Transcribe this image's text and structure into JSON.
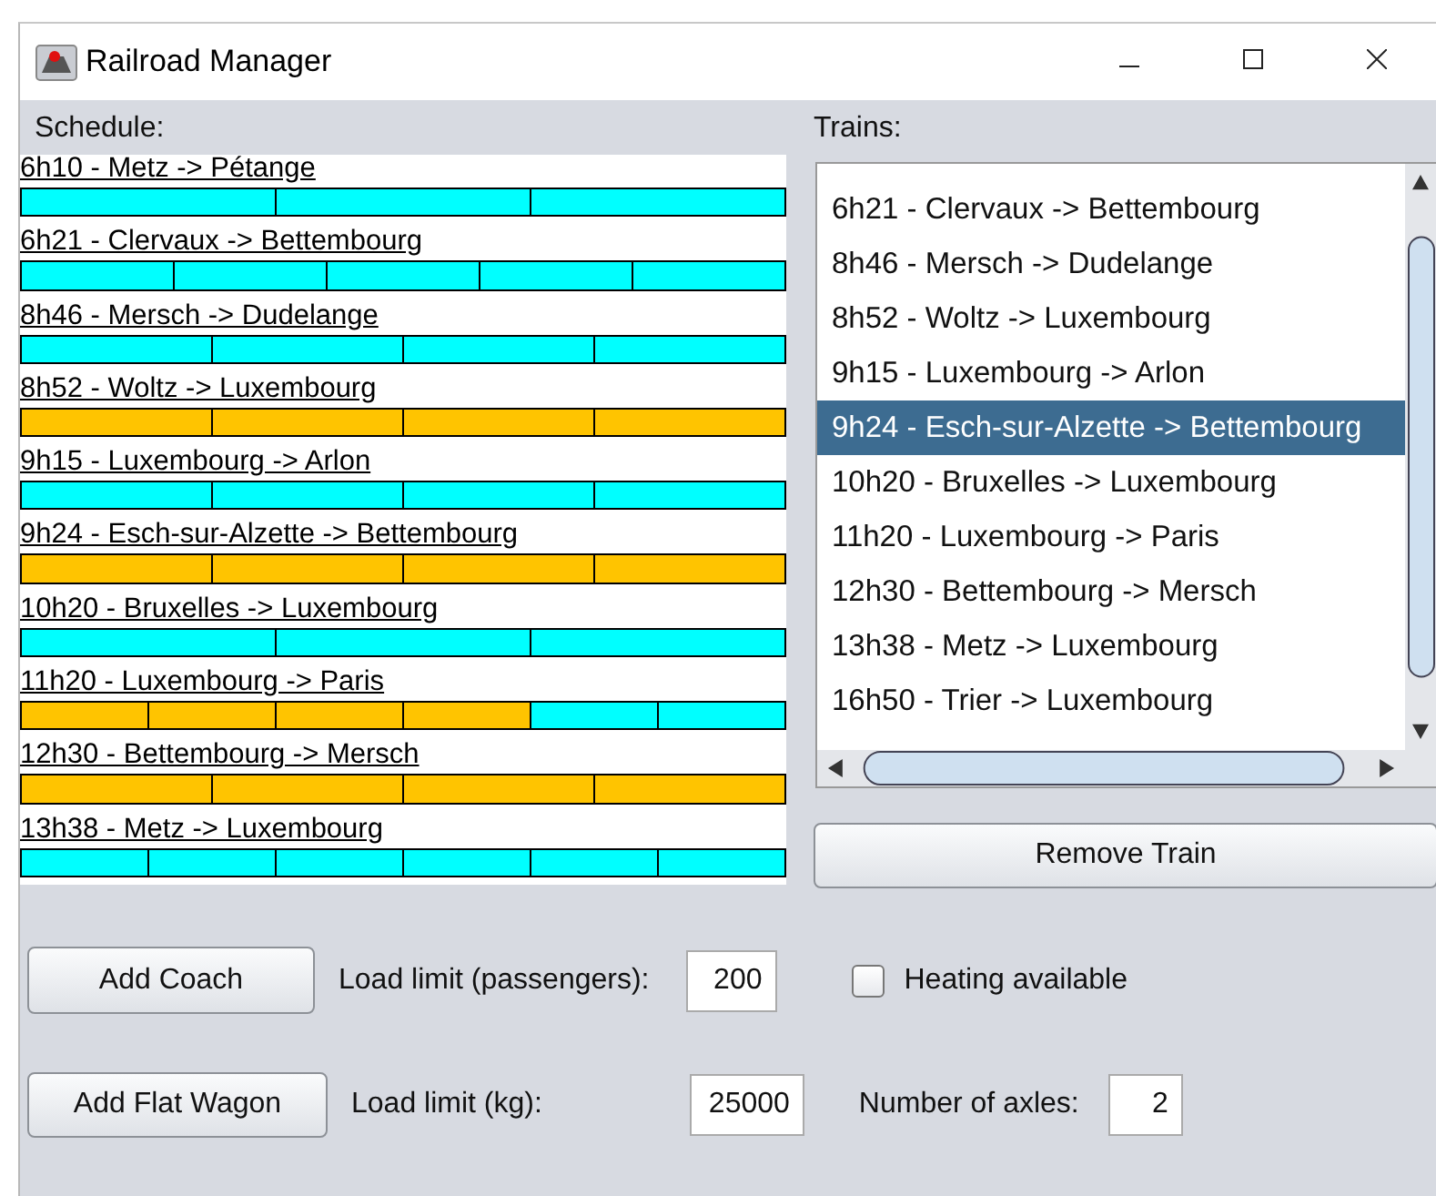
{
  "window": {
    "title": "Railroad Manager"
  },
  "schedule": {
    "label": "Schedule:",
    "trains": [
      {
        "name": "6h10 - Metz -> Pétange",
        "wagons": [
          {
            "color": "#00ffff"
          },
          {
            "color": "#00ffff"
          },
          {
            "color": "#00ffff"
          }
        ]
      },
      {
        "name": "6h21 - Clervaux -> Bettembourg",
        "wagons": [
          {
            "color": "#00ffff"
          },
          {
            "color": "#00ffff"
          },
          {
            "color": "#00ffff"
          },
          {
            "color": "#00ffff"
          },
          {
            "color": "#00ffff"
          }
        ]
      },
      {
        "name": "8h46 - Mersch -> Dudelange",
        "wagons": [
          {
            "color": "#00ffff"
          },
          {
            "color": "#00ffff"
          },
          {
            "color": "#00ffff"
          },
          {
            "color": "#00ffff"
          }
        ]
      },
      {
        "name": "8h52 - Woltz -> Luxembourg",
        "wagons": [
          {
            "color": "#ffc400"
          },
          {
            "color": "#ffc400"
          },
          {
            "color": "#ffc400"
          },
          {
            "color": "#ffc400"
          }
        ]
      },
      {
        "name": "9h15 - Luxembourg -> Arlon",
        "wagons": [
          {
            "color": "#00ffff"
          },
          {
            "color": "#00ffff"
          },
          {
            "color": "#00ffff"
          },
          {
            "color": "#00ffff"
          }
        ]
      },
      {
        "name": "9h24 - Esch-sur-Alzette -> Bettembourg",
        "wagons": [
          {
            "color": "#ffc400"
          },
          {
            "color": "#ffc400"
          },
          {
            "color": "#ffc400"
          },
          {
            "color": "#ffc400"
          }
        ]
      },
      {
        "name": "10h20 - Bruxelles -> Luxembourg",
        "wagons": [
          {
            "color": "#00ffff"
          },
          {
            "color": "#00ffff"
          },
          {
            "color": "#00ffff"
          }
        ]
      },
      {
        "name": "11h20 - Luxembourg -> Paris",
        "wagons": [
          {
            "color": "#ffc400"
          },
          {
            "color": "#ffc400"
          },
          {
            "color": "#ffc400"
          },
          {
            "color": "#ffc400"
          },
          {
            "color": "#00ffff"
          },
          {
            "color": "#00ffff"
          }
        ]
      },
      {
        "name": "12h30 - Bettembourg -> Mersch",
        "wagons": [
          {
            "color": "#ffc400"
          },
          {
            "color": "#ffc400"
          },
          {
            "color": "#ffc400"
          },
          {
            "color": "#ffc400"
          }
        ]
      },
      {
        "name": "13h38 - Metz -> Luxembourg",
        "wagons": [
          {
            "color": "#00ffff"
          },
          {
            "color": "#00ffff"
          },
          {
            "color": "#00ffff"
          },
          {
            "color": "#00ffff"
          },
          {
            "color": "#00ffff"
          },
          {
            "color": "#00ffff"
          }
        ]
      }
    ]
  },
  "trains": {
    "label": "Trains:",
    "items": [
      {
        "name": "6h21 - Clervaux -> Bettembourg",
        "selected": false
      },
      {
        "name": "8h46 - Mersch -> Dudelange",
        "selected": false
      },
      {
        "name": "8h52 - Woltz -> Luxembourg",
        "selected": false
      },
      {
        "name": "9h15 - Luxembourg -> Arlon",
        "selected": false
      },
      {
        "name": "9h24 - Esch-sur-Alzette -> Bettembourg",
        "selected": true
      },
      {
        "name": "10h20 - Bruxelles -> Luxembourg",
        "selected": false
      },
      {
        "name": "11h20 - Luxembourg -> Paris",
        "selected": false
      },
      {
        "name": "12h30 - Bettembourg -> Mersch",
        "selected": false
      },
      {
        "name": "13h38 - Metz -> Luxembourg",
        "selected": false
      },
      {
        "name": "16h50 - Trier -> Luxembourg",
        "selected": false
      }
    ],
    "remove_button": "Remove Train"
  },
  "coach": {
    "button": "Add Coach",
    "load_label": "Load limit (passengers):",
    "load_value": "200",
    "heating": {
      "label": "Heating available",
      "checked": false
    }
  },
  "flat_wagon": {
    "button": "Add Flat Wagon",
    "load_label": "Load limit (kg):",
    "load_value": "25000",
    "axles_label": "Number of axles:",
    "axles_value": "2"
  }
}
